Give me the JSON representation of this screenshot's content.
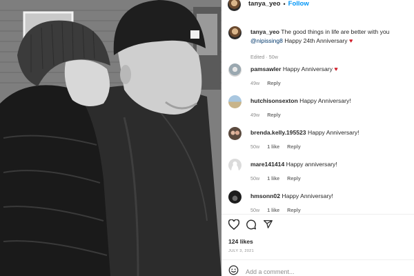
{
  "post": {
    "author": "tanya_yeo",
    "follow_label": "Follow",
    "separator": "•",
    "caption_text_pre": "The good things in life are better with you",
    "caption_mention": "@nipissing8",
    "caption_text_post": "Happy 24th Anniversary",
    "caption_emoji": "♥",
    "caption_meta": "Edited · 50w"
  },
  "comments": [
    {
      "user": "pamsawler",
      "text": "Happy Anniversary",
      "emoji": "♥",
      "time": "49w",
      "likes": "",
      "reply": "Reply"
    },
    {
      "user": "hutchisonsexton",
      "text": "Happy Anniversary!",
      "emoji": "",
      "time": "49w",
      "likes": "",
      "reply": "Reply"
    },
    {
      "user": "brenda.kelly.195523",
      "text": "Happy Anniversary!",
      "emoji": "",
      "time": "50w",
      "likes": "1 like",
      "reply": "Reply"
    },
    {
      "user": "mare141414",
      "text": "Happy anniversary!",
      "emoji": "",
      "time": "50w",
      "likes": "1 like",
      "reply": "Reply"
    },
    {
      "user": "hmsonn02",
      "text": "Happy Anniversary!",
      "emoji": "",
      "time": "50w",
      "likes": "1 like",
      "reply": "Reply"
    }
  ],
  "footer": {
    "likes": "124 likes",
    "date": "JULY 3, 2021",
    "add_comment_placeholder": "Add a comment..."
  },
  "icons": {
    "like": "heart-icon",
    "comment": "comment-icon",
    "share": "share-icon",
    "emoji": "emoji-icon"
  },
  "colors": {
    "link": "#0095f6",
    "mention": "#00376b",
    "heart": "#d01e2a",
    "meta": "#8e8e8e"
  }
}
